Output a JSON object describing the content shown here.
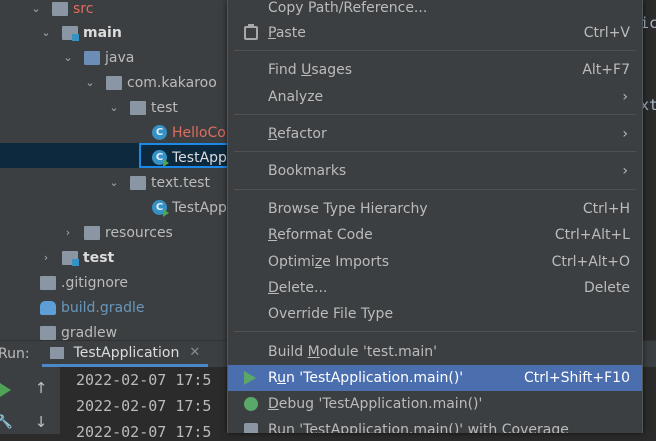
{
  "editor": {
    "fragment_1": "ic",
    "fragment_2": "xt"
  },
  "tree": {
    "items": [
      {
        "label": "src"
      },
      {
        "label": "main"
      },
      {
        "label": "java"
      },
      {
        "label": "com.kakaroo"
      },
      {
        "label": "test"
      },
      {
        "label": "HelloCo",
        "icon_letter": "C"
      },
      {
        "label": "TestApp",
        "icon_letter": "C"
      },
      {
        "label": "text.test"
      },
      {
        "label": "TestApp",
        "icon_letter": "C"
      },
      {
        "label": "resources"
      },
      {
        "label": "test"
      },
      {
        "label": ".gitignore"
      },
      {
        "label": "build.gradle"
      },
      {
        "label": "gradlew"
      }
    ]
  },
  "run_window": {
    "label": "Run:",
    "tab_label": "TestApplication",
    "close_glyph": "✕",
    "up_glyph": "↑",
    "down_glyph": "↓",
    "wrench_glyph": "🔧",
    "log_lines": [
      "2022-02-07 17:5",
      "2022-02-07 17:5",
      "2022-02-07 17:5"
    ]
  },
  "menu": {
    "copy_path": "Copy Path/Reference...",
    "paste": {
      "before": "",
      "mnemonic": "P",
      "after": "aste",
      "shortcut": "Ctrl+V"
    },
    "find_usages": {
      "before": "Find ",
      "mnemonic": "U",
      "after": "sages",
      "shortcut": "Alt+F7"
    },
    "analyze": "Analyze",
    "refactor": {
      "before": "",
      "mnemonic": "R",
      "after": "efactor"
    },
    "bookmarks": "Bookmarks",
    "browse_type_hierarchy": {
      "label": "Browse Type Hierarchy",
      "shortcut": "Ctrl+H"
    },
    "reformat_code": {
      "before": "",
      "mnemonic": "R",
      "after": "eformat Code",
      "shortcut": "Ctrl+Alt+L"
    },
    "optimize_imports": {
      "before": "Optimi",
      "mnemonic": "z",
      "after": "e Imports",
      "shortcut": "Ctrl+Alt+O"
    },
    "delete": {
      "before": "",
      "mnemonic": "D",
      "after": "elete...",
      "shortcut": "Delete"
    },
    "override_file_type": "Override File Type",
    "build_module": {
      "before": "Build ",
      "mnemonic": "M",
      "after": "odule 'test.main'"
    },
    "run": {
      "before": "R",
      "mnemonic": "u",
      "after": "n 'TestApplication.main()'",
      "shortcut": "Ctrl+Shift+F10"
    },
    "debug": {
      "before": "",
      "mnemonic": "D",
      "after": "ebug 'TestApplication.main()'"
    },
    "run_coverage": "Run 'TestApplication.main()' with Coverage",
    "submenu_glyph": "›"
  },
  "colors": {
    "menu_highlight": "#4b6eaf",
    "selection_border": "#1e88e5",
    "run_green": "#59a869"
  }
}
